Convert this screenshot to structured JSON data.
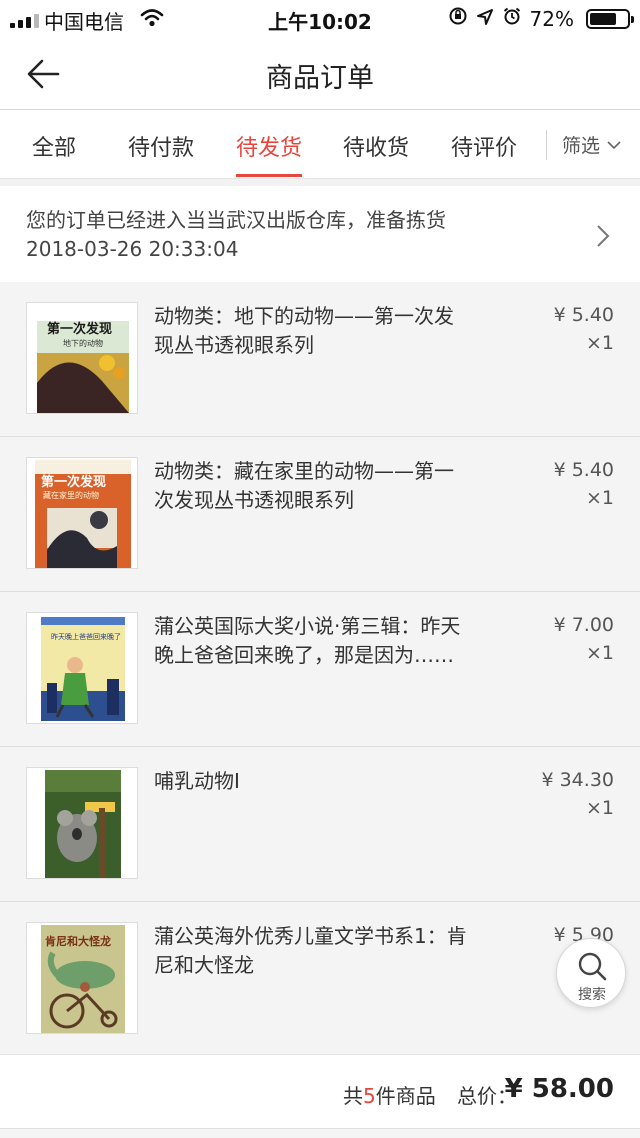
{
  "status_bar": {
    "carrier": "中国电信",
    "time": "上午10:02",
    "battery": "72%",
    "battery_level": 0.72,
    "icons": [
      "signal-icon",
      "wifi-icon",
      "rotation-lock-icon",
      "location-icon",
      "alarm-icon",
      "battery-icon"
    ]
  },
  "nav": {
    "title": "商品订单",
    "back_icon": "back-arrow-icon"
  },
  "tabs": {
    "items": [
      {
        "label": "全部"
      },
      {
        "label": "待付款"
      },
      {
        "label": "待发货"
      },
      {
        "label": "待收货"
      },
      {
        "label": "待评价"
      }
    ],
    "active_label": "待发货",
    "filter_label": "筛选",
    "accent_color": "#e8453c"
  },
  "notice": {
    "message": "您的订单已经进入当当武汉出版仓库，准备拣货",
    "time": "2018-03-26 20:33:04"
  },
  "items": [
    {
      "title_line1": "动物类：地下的动物——第一次发",
      "title_line2": "现丛书透视眼系列",
      "price": "¥ 5.40",
      "qty": "×1"
    },
    {
      "title_line1": "动物类：藏在家里的动物——第一",
      "title_line2": "次发现丛书透视眼系列",
      "price": "¥ 5.40",
      "qty": "×1"
    },
    {
      "title_line1": "蒲公英国际大奖小说·第三辑：昨天",
      "title_line2": "晚上爸爸回来晚了，那是因为……",
      "price": "¥ 7.00",
      "qty": "×1"
    },
    {
      "title_line1": "哺乳动物I",
      "title_line2": "",
      "price": "¥ 34.30",
      "qty": "×1"
    },
    {
      "title_line1": "蒲公英海外优秀儿童文学书系1：肯",
      "title_line2": "尼和大怪龙",
      "price": "¥ 5.90",
      "qty": ""
    }
  ],
  "covers": {
    "book1_series": "第一次发现",
    "book1_subtitle": "地下的动物",
    "book2_series": "第一次发现",
    "book2_subtitle": "藏在家里的动物",
    "book3_text": "昨天晚上爸爸回来晚了",
    "book5_title": "肯尼和大怪龙"
  },
  "float_search": {
    "label": "搜索"
  },
  "summary": {
    "count_prefix": "共",
    "count": "5",
    "count_suffix": "件商品",
    "total_label": "总价：",
    "total": "¥ 58.00"
  }
}
